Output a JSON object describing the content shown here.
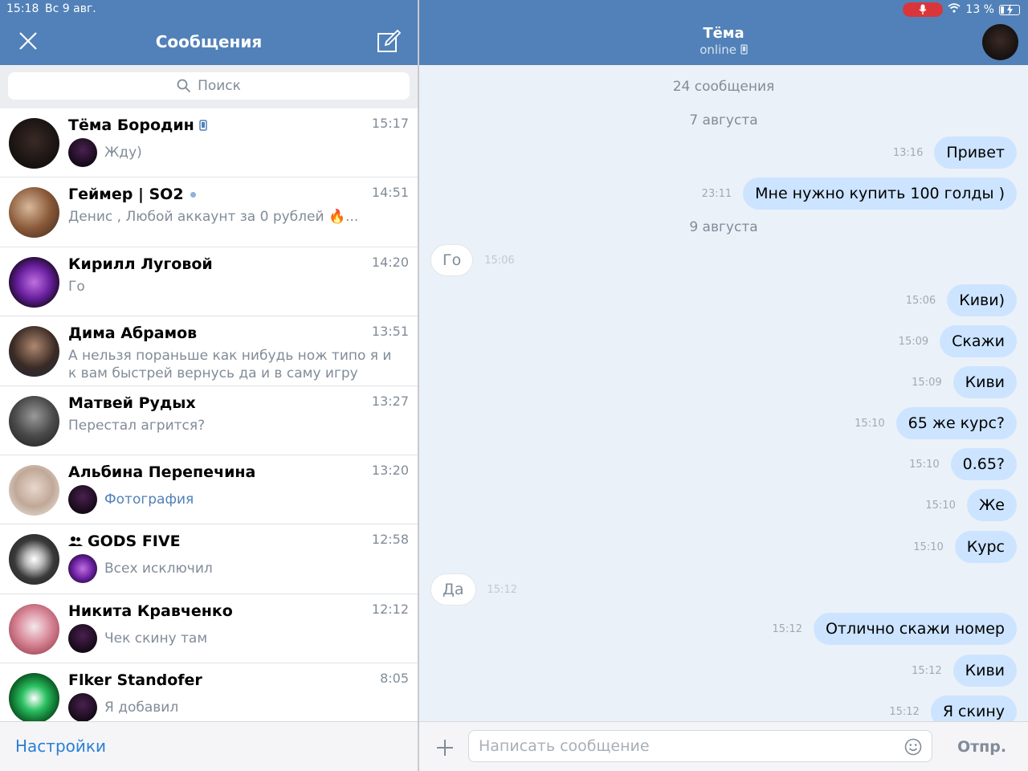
{
  "status_bar": {
    "time": "15:18",
    "date": "Вс 9 авг.",
    "battery": "13 %"
  },
  "left": {
    "title": "Сообщения",
    "search_placeholder": "Поиск",
    "footer_link": "Настройки"
  },
  "chats": [
    {
      "name": "Тёма Бородин",
      "time": "15:17",
      "preview": "Жду)"
    },
    {
      "name": "Геймер | SO2",
      "time": "14:51",
      "preview": "Денис , Любой аккаунт за 0 рублей 🔥..."
    },
    {
      "name": "Кирилл Луговой",
      "time": "14:20",
      "preview": "Го"
    },
    {
      "name": "Дима Абрамов",
      "time": "13:51",
      "preview": "А нельзя пораньше как нибудь нож типо я и к вам быстрей вернусь да и в саму игру"
    },
    {
      "name": "Матвей Рудых",
      "time": "13:27",
      "preview": "Перестал агрится?"
    },
    {
      "name": "Альбина Перепечина",
      "time": "13:20",
      "preview": "Фотография"
    },
    {
      "name": "GODS FIVE",
      "time": "12:58",
      "preview": "Всех исключил"
    },
    {
      "name": "Никита Кравченко",
      "time": "12:12",
      "preview": "Чек скину там"
    },
    {
      "name": "Flker Standofer",
      "time": "8:05",
      "preview": "Я добавил"
    }
  ],
  "conversation": {
    "peer_name": "Тёма",
    "peer_status": "online",
    "message_count": "24 сообщения",
    "date_1": "7 августа",
    "date_2": "9 августа",
    "messages": [
      {
        "dir": "out",
        "text": "Привет",
        "time": "13:16"
      },
      {
        "dir": "out",
        "text": "Мне нужно купить 100 голды )",
        "time": "23:11"
      },
      {
        "dir": "in",
        "text": "Го",
        "time": "15:06"
      },
      {
        "dir": "out",
        "text": "Киви)",
        "time": "15:06"
      },
      {
        "dir": "out",
        "text": "Скажи",
        "time": "15:09"
      },
      {
        "dir": "out",
        "text": "Киви",
        "time": "15:09"
      },
      {
        "dir": "out",
        "text": "65 же курс?",
        "time": "15:10"
      },
      {
        "dir": "out",
        "text": "0.65?",
        "time": "15:10"
      },
      {
        "dir": "out",
        "text": "Же",
        "time": "15:10"
      },
      {
        "dir": "out",
        "text": "Курс",
        "time": "15:10"
      },
      {
        "dir": "in",
        "text": "Да",
        "time": "15:12"
      },
      {
        "dir": "out",
        "text": "Отлично скажи номер",
        "time": "15:12"
      },
      {
        "dir": "out",
        "text": "Киви",
        "time": "15:12"
      },
      {
        "dir": "out",
        "text": "Я скину",
        "time": "15:12"
      }
    ]
  },
  "composer": {
    "placeholder": "Написать сообщение",
    "send_label": "Отпр."
  },
  "colors": {
    "header": "#5181b8",
    "out_bubble": "#cce4ff",
    "chat_bg": "#ebf1f8",
    "link": "#2a7fd4"
  }
}
